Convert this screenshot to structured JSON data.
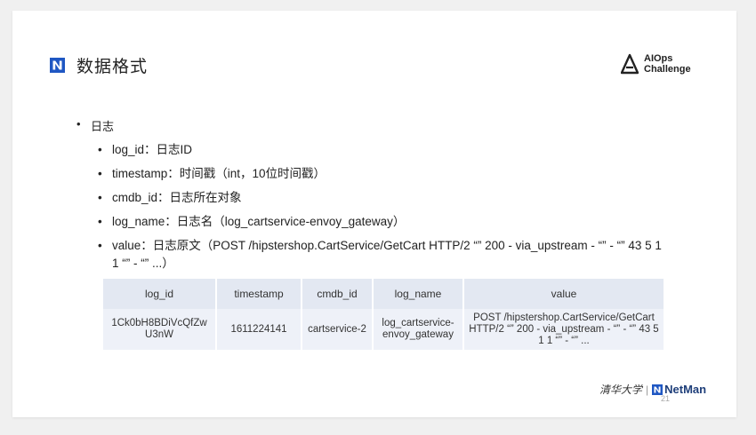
{
  "slide": {
    "title": "数据格式",
    "logo_text_1": "AIOps",
    "logo_text_2": "Challenge",
    "section": "日志",
    "bullets": [
      "log_id：日志ID",
      "timestamp：时间戳（int，10位时间戳）",
      "cmdb_id：日志所在对象",
      "log_name：日志名（log_cartservice-envoy_gateway）",
      "value：日志原文（POST /hipstershop.CartService/GetCart HTTP/2 “” 200 - via_upstream - “” - “” 43 5 1 1 “” - “” ...）"
    ],
    "page_number": "21",
    "footer_left": "清华大学",
    "footer_sep": "|",
    "footer_right": "NetMan"
  },
  "table": {
    "headers": [
      "log_id",
      "timestamp",
      "cmdb_id",
      "log_name",
      "value"
    ],
    "row": [
      "1Ck0bH8BDiVcQfZw U3nW",
      "1611224141",
      "cartservice-2",
      "log_cartservice-envoy_gateway",
      "POST /hipstershop.CartService/GetCart HTTP/2 “” 200 - via_upstream - “” - “” 43 5 1 1 “” - “” ..."
    ]
  },
  "colors": {
    "brand_blue": "#1f57c3",
    "header_bg": "#e3e8f2",
    "row_bg": "#eef1f8"
  }
}
